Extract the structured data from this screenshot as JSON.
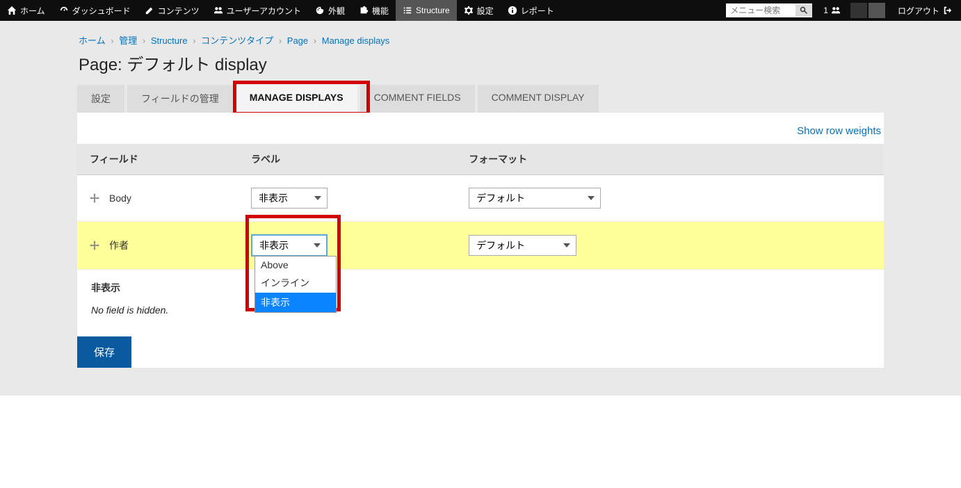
{
  "adminbar": {
    "items": [
      {
        "label": "ホーム"
      },
      {
        "label": "ダッシュボード"
      },
      {
        "label": "コンテンツ"
      },
      {
        "label": "ユーザーアカウント"
      },
      {
        "label": "外観"
      },
      {
        "label": "機能"
      },
      {
        "label": "Structure"
      },
      {
        "label": "設定"
      },
      {
        "label": "レポート"
      }
    ],
    "search_placeholder": "メニュー検索",
    "user_count": "1",
    "logout": "ログアウト"
  },
  "breadcrumb": {
    "items": [
      "ホーム",
      "管理",
      "Structure",
      "コンテンツタイプ",
      "Page",
      "Manage displays"
    ]
  },
  "page_title": "Page: デフォルト display",
  "tabs": {
    "items": [
      "設定",
      "フィールドの管理",
      "MANAGE DISPLAYS",
      "COMMENT FIELDS",
      "COMMENT DISPLAY"
    ]
  },
  "show_row_weights": "Show row weights",
  "table": {
    "headers": {
      "field": "フィールド",
      "label": "ラベル",
      "format": "フォーマット"
    },
    "rows": [
      {
        "field": "Body",
        "label_value": "非表示",
        "format_value": "デフォルト"
      },
      {
        "field": "作者",
        "label_value": "非表示",
        "format_value": "デフォルト"
      }
    ]
  },
  "dropdown_options": {
    "above": "Above",
    "inline": "インライン",
    "hidden": "非表示"
  },
  "hidden_section": {
    "header": "非表示",
    "message": "No field is hidden."
  },
  "save_button": "保存"
}
